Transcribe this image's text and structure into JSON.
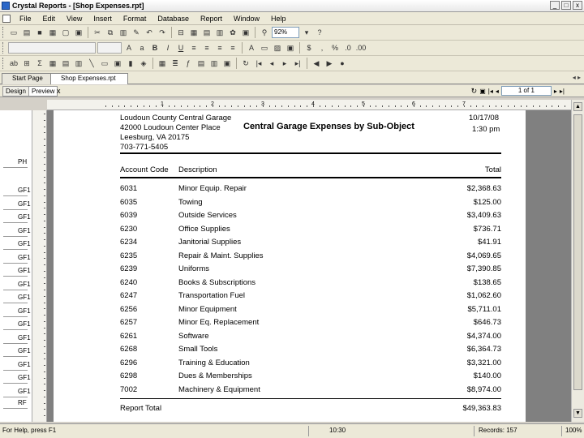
{
  "window": {
    "title": "Crystal Reports - [Shop Expenses.rpt]",
    "controls": [
      "_",
      "□",
      "x"
    ]
  },
  "menu": [
    "File",
    "Edit",
    "View",
    "Insert",
    "Format",
    "Database",
    "Report",
    "Window",
    "Help"
  ],
  "toolbar": {
    "zoom": "92%"
  },
  "tabs": [
    {
      "label": "Start Page"
    },
    {
      "label": "Shop Expenses.rpt"
    }
  ],
  "view_tabs": {
    "design": "Design",
    "preview": "Preview"
  },
  "nav": {
    "page_indicator": "1 of 1",
    "close": "x"
  },
  "ruler_numbers": [
    "1",
    "2",
    "3",
    "4",
    "5",
    "6",
    "7"
  ],
  "sections": [
    "PH",
    "GF1",
    "GF1",
    "GF1",
    "GF1",
    "GF1",
    "GF1",
    "GF1",
    "GF1",
    "GF1",
    "GF1",
    "GF1",
    "GF1",
    "GF1",
    "GF1",
    "GF1",
    "GF1",
    "RF"
  ],
  "report": {
    "company_lines": [
      "Loudoun County Central Garage",
      "42000 Loudoun Center Place",
      "Leesburg, VA 20175",
      "703-771-5405"
    ],
    "title": "Central Garage Expenses by Sub-Object",
    "date": "10/17/08",
    "time": "1:30 pm",
    "headers": {
      "code": "Account Code",
      "desc": "Description",
      "total": "Total"
    },
    "rows": [
      {
        "code": "6031",
        "desc": "Minor Equip. Repair",
        "total": "$2,368.63"
      },
      {
        "code": "6035",
        "desc": "Towing",
        "total": "$125.00"
      },
      {
        "code": "6039",
        "desc": "Outside Services",
        "total": "$3,409.63"
      },
      {
        "code": "6230",
        "desc": "Office Supplies",
        "total": "$736.71"
      },
      {
        "code": "6234",
        "desc": "Janitorial Supplies",
        "total": "$41.91"
      },
      {
        "code": "6235",
        "desc": "Repair & Maint. Supplies",
        "total": "$4,069.65"
      },
      {
        "code": "6239",
        "desc": "Uniforms",
        "total": "$7,390.85"
      },
      {
        "code": "6240",
        "desc": "Books & Subscriptions",
        "total": "$138.65"
      },
      {
        "code": "6247",
        "desc": "Transportation Fuel",
        "total": "$1,062.60"
      },
      {
        "code": "6256",
        "desc": "Minor Equipment",
        "total": "$5,711.01"
      },
      {
        "code": "6257",
        "desc": "Minor Eq. Replacement",
        "total": "$646.73"
      },
      {
        "code": "6261",
        "desc": "Software",
        "total": "$4,374.00"
      },
      {
        "code": "6268",
        "desc": "Small Tools",
        "total": "$6,364.73"
      },
      {
        "code": "6296",
        "desc": "Training & Education",
        "total": "$3,321.00"
      },
      {
        "code": "6298",
        "desc": "Dues & Memberships",
        "total": "$140.00"
      },
      {
        "code": "7002",
        "desc": "Machinery & Equipment",
        "total": "$8,974.00"
      }
    ],
    "footer_label": "Report Total",
    "footer_total": "$49,363.83"
  },
  "status": {
    "help": "For Help, press F1",
    "time": "10:30",
    "records": "Records: 157",
    "zoom": "100%"
  }
}
